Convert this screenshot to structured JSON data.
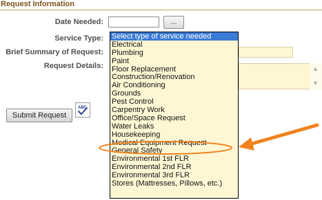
{
  "section": {
    "title": "Request Information"
  },
  "form": {
    "date_needed_label": "Date Needed:",
    "date_needed_value": "",
    "date_picker_label": "...",
    "service_type_label": "Service Type:",
    "summary_label": "Brief Summary of Request:",
    "summary_value": "",
    "details_label": "Request Details:",
    "details_value": "",
    "submit_label": "Submit Request",
    "spellcheck_icon": "spellcheck-icon"
  },
  "service_dropdown": {
    "selected": "Select type of service needed",
    "options": [
      "Select type of service needed",
      "Electrical",
      "Plumbing",
      "Paint",
      "Floor Replacement",
      "Construction/Renovation",
      "Air Conditioning",
      "Grounds",
      "Pest Control",
      "Carpentry Work",
      "Office/Space Request",
      "Water Leaks",
      "Housekeeping",
      "Medical Equipment Request",
      "General Safety",
      "Environmental 1st FLR",
      "Environmental 2nd FLR",
      "Environmental 3rd FLR",
      "Stores (Mattresses, Pillows, etc.)"
    ],
    "highlighted_option": "Medical Equipment Request"
  },
  "annotation": {
    "arrow_icon": "arrow-left-icon",
    "highlight_color": "#f0831e"
  },
  "colors": {
    "title_text": "#7a5218",
    "title_rule": "#c7a46a",
    "field_bg": "#fff7d4",
    "selected_option_bg": "#3a7bd5"
  }
}
